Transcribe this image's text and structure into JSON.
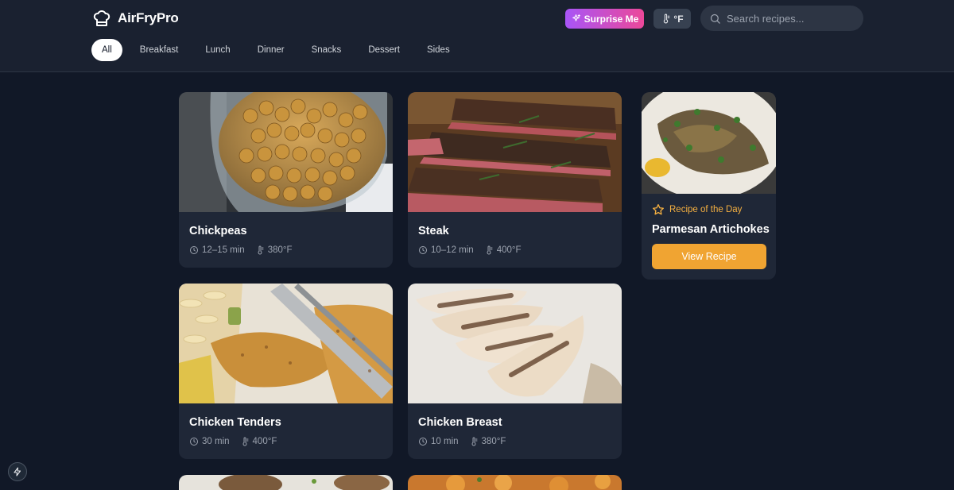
{
  "brand": {
    "name": "AirFryPro",
    "icon": "chef-hat-icon"
  },
  "header": {
    "surprise_label": "Surprise Me",
    "unit_label": "°F",
    "search_placeholder": "Search recipes..."
  },
  "tabs": [
    "All",
    "Breakfast",
    "Lunch",
    "Dinner",
    "Snacks",
    "Dessert",
    "Sides"
  ],
  "active_tab": "All",
  "recipes": [
    {
      "title": "Chickpeas",
      "time": "12–15 min",
      "temp": "380°F"
    },
    {
      "title": "Steak",
      "time": "10–12 min",
      "temp": "400°F"
    },
    {
      "title": "Chicken Tenders",
      "time": "30 min",
      "temp": "400°F"
    },
    {
      "title": "Chicken Breast",
      "time": "10 min",
      "temp": "380°F"
    }
  ],
  "recipe_of_day": {
    "label": "Recipe of the Day",
    "name": "Parmesan Artichokes",
    "button": "View Recipe"
  },
  "colors": {
    "background": "#111827",
    "header": "#1a2130",
    "card": "#1f2737",
    "accent": "#f0a432",
    "surprise_gradient": [
      "#a855f7",
      "#ec4899"
    ]
  }
}
